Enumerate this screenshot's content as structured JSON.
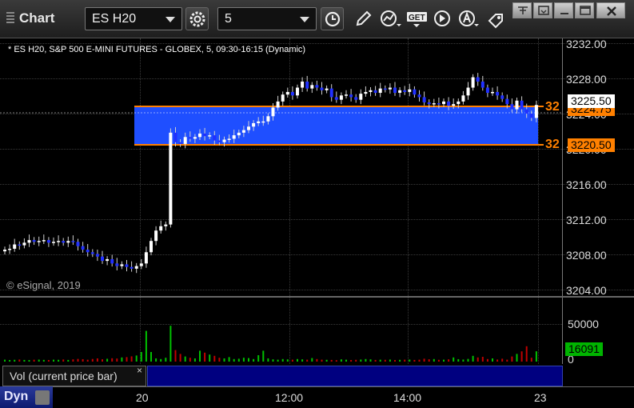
{
  "toolbar": {
    "title": "Chart",
    "symbol": "ES H20",
    "interval": "5"
  },
  "chart": {
    "header": "* ES H20, S&P 500 E-MINI FUTURES - GLOBEX, 5, 09:30-16:15 (Dynamic)",
    "copyright": "© eSignal, 2019",
    "y_ticks": [
      "3232.00",
      "3228.00",
      "3224.00",
      "3220.00",
      "3216.00",
      "3212.00",
      "3208.00",
      "3204.00"
    ],
    "x_ticks": [
      "20",
      "12:00",
      "14:00",
      "23"
    ],
    "last_price": "3225.50",
    "upper_level": "3224.75",
    "upper_level_short": "32",
    "lower_level": "3220.50",
    "lower_level_short": "32",
    "accent_blue": "#1f4fff",
    "level_color": "#ff8000"
  },
  "volume": {
    "label": "Vol (current price bar)",
    "close": "×",
    "y_ticks": [
      "50000",
      "0"
    ],
    "current": "16091"
  },
  "footer": {
    "mode": "Dyn"
  },
  "chart_data": {
    "type": "candlestick",
    "title": "ES H20, S&P 500 E-MINI FUTURES - GLOBEX, 5, 09:30-16:15 (Dynamic)",
    "ylim": [
      3204,
      3233
    ],
    "x_ticks": [
      "20",
      "12:00",
      "14:00",
      "23"
    ],
    "last": 3225.5,
    "levels": [
      3224.75,
      3220.5
    ],
    "closes": [
      3208.8,
      3208.9,
      3209.4,
      3209.3,
      3209.6,
      3209.9,
      3209.7,
      3209.8,
      3209.9,
      3209.6,
      3209.7,
      3209.8,
      3209.6,
      3209.8,
      3209.7,
      3209.2,
      3208.8,
      3208.5,
      3208.3,
      3208.0,
      3207.5,
      3207.7,
      3207.2,
      3206.9,
      3207.1,
      3206.8,
      3206.6,
      3206.9,
      3207.2,
      3208.5,
      3209.8,
      3211.0,
      3211.5,
      3211.7,
      3222.3,
      3221.2,
      3221.0,
      3221.8,
      3221.6,
      3221.8,
      3222.2,
      3221.9,
      3222.0,
      3221.4,
      3221.2,
      3221.5,
      3221.6,
      3222.0,
      3222.3,
      3222.6,
      3223.0,
      3223.4,
      3223.6,
      3223.6,
      3224.2,
      3225.2,
      3225.9,
      3226.7,
      3227.0,
      3226.6,
      3227.5,
      3228.2,
      3227.4,
      3227.8,
      3227.5,
      3227.2,
      3227.4,
      3226.4,
      3226.1,
      3226.6,
      3226.7,
      3226.4,
      3226.1,
      3226.8,
      3227.0,
      3227.2,
      3226.9,
      3227.4,
      3227.3,
      3227.5,
      3226.9,
      3227.2,
      3227.0,
      3227.3,
      3226.7,
      3226.4,
      3225.8,
      3225.6,
      3225.7,
      3225.6,
      3225.9,
      3225.4,
      3225.6,
      3225.9,
      3226.6,
      3227.5,
      3228.7,
      3228.2,
      3227.5,
      3226.9,
      3227.0,
      3226.6,
      3226.2,
      3225.6,
      3225.0,
      3226.0,
      3225.0,
      3224.5,
      3224.0,
      3225.5
    ],
    "volumes": [
      3000,
      2500,
      2800,
      3200,
      2600,
      2400,
      2900,
      3100,
      2700,
      2500,
      3000,
      2800,
      3300,
      2600,
      3500,
      4200,
      3800,
      2900,
      4100,
      5000,
      3600,
      4400,
      5200,
      4800,
      6500,
      7000,
      8200,
      9500,
      15000,
      48000,
      15000,
      5000,
      4000,
      6000,
      56000,
      18000,
      12000,
      8000,
      6000,
      5000,
      17000,
      14000,
      11000,
      9000,
      6000,
      5000,
      7000,
      4000,
      4500,
      6000,
      5500,
      4000,
      10000,
      17000,
      5000,
      3500,
      3000,
      4000,
      3500,
      3000,
      4000,
      3500,
      3000,
      5500,
      4000,
      3000,
      2800,
      2600,
      2200,
      3500,
      3000,
      2500,
      2800,
      3200,
      4000,
      3500,
      2600,
      3000,
      2800,
      3200,
      2500,
      2800,
      3000,
      3200,
      2600,
      3000,
      4500,
      3600,
      4000,
      2800,
      3000,
      3500,
      6500,
      3800,
      3200,
      4200,
      9000,
      6500,
      7500,
      4000,
      5000,
      3200,
      4500,
      3000,
      8000,
      12000,
      16000,
      24000,
      6000,
      16091
    ]
  }
}
